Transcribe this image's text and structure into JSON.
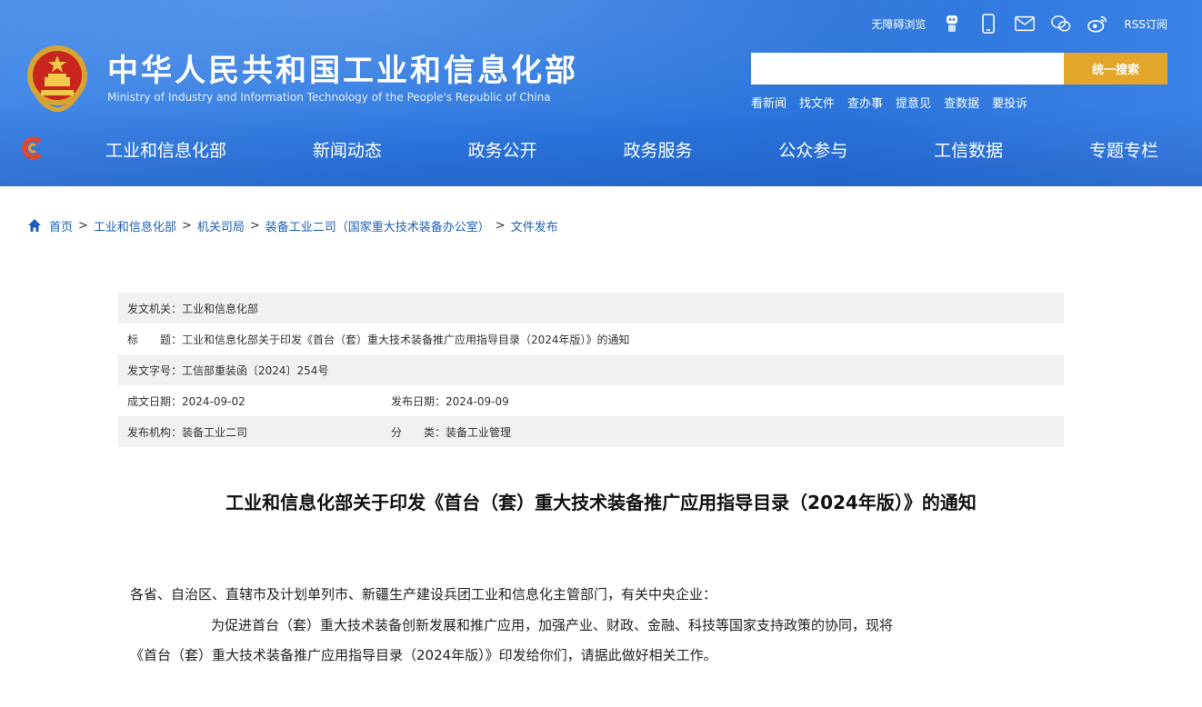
{
  "header": {
    "title": "中华人民共和国工业和信息化部",
    "subtitle": "Ministry of Industry and Information Technology of the People's Republic of China",
    "toplinks": {
      "accessibility": "无障碍浏览",
      "rss": "RSS订阅"
    },
    "search": {
      "placeholder": "",
      "button_label": "统一搜索"
    },
    "quicklinks": [
      "看新闻",
      "找文件",
      "查办事",
      "提意见",
      "查数据",
      "要投诉"
    ],
    "nav": [
      "工业和信息化部",
      "新闻动态",
      "政务公开",
      "政务服务",
      "公众参与",
      "工信数据",
      "专题专栏"
    ]
  },
  "breadcrumb": [
    "首页",
    "工业和信息化部",
    "机关司局",
    "装备工业二司（国家重大技术装备办公室）",
    "文件发布"
  ],
  "meta": {
    "issuer": "发文机关：工业和信息化部",
    "title_line": "标　　题：工业和信息化部关于印发《首台（套）重大技术装备推广应用指导目录（2024年版）》的通知",
    "doc_number": "发文字号：工信部重装函〔2024〕254号",
    "created_date": "成文日期：2024-09-02",
    "published_date": "发布日期：2024-09-09",
    "publisher": "发布机构：装备工业二司",
    "category": "分　　类：装备工业管理"
  },
  "article": {
    "title": "工业和信息化部关于印发《首台（套）重大技术装备推广应用指导目录（2024年版）》的通知",
    "addressee": "各省、自治区、直辖市及计划单列市、新疆生产建设兵团工业和信息化主管部门，有关中央企业：",
    "para1": "为促进首台（套）重大技术装备创新发展和推广应用，加强产业、财政、金融、科技等国家支持政策的协同，现将",
    "para2": "《首台（套）重大技术装备推广应用指导目录（2024年版）》印发给你们，请据此做好相关工作。"
  }
}
